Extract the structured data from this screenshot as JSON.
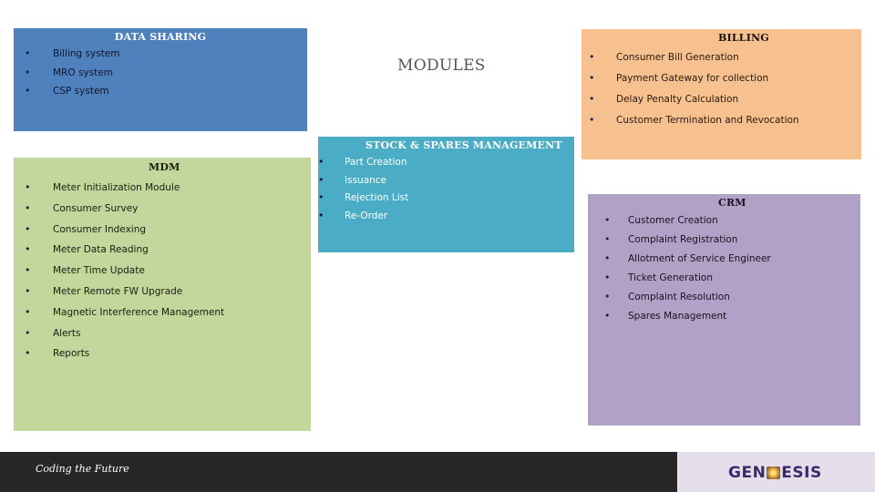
{
  "page": {
    "title": "MODULES"
  },
  "colors": {
    "data_sharing_bg": "#4f81bd",
    "billing_bg": "#f6c08f",
    "stock_bg": "#4bacc6",
    "mdm_bg": "#c3d69b",
    "crm_bg": "#b2a1c7",
    "footer_dark": "#262626",
    "footer_light": "#e5dfec",
    "logo_color": "#3b2a6b"
  },
  "modules": {
    "data_sharing": {
      "title": "DATA SHARING",
      "items": [
        "Billing system",
        "MRO system",
        "CSP system"
      ]
    },
    "billing": {
      "title": "BILLING",
      "items": [
        "Consumer Bill Generation",
        "Payment Gateway for collection",
        "Delay Penalty Calculation",
        "Customer Termination and Revocation"
      ]
    },
    "stock": {
      "title": "STOCK & SPARES MANAGEMENT",
      "items": [
        "Part Creation",
        "Issuance",
        "Rejection List",
        "Re-Order"
      ]
    },
    "mdm": {
      "title": "MDM",
      "items": [
        "Meter Initialization Module",
        "Consumer Survey",
        "Consumer Indexing",
        "Meter Data Reading",
        "Meter Time Update",
        "Meter Remote FW Upgrade",
        "Magnetic Interference Management",
        "Alerts",
        "Reports"
      ]
    },
    "crm": {
      "title": "CRM",
      "items": [
        "Customer Creation",
        "Complaint Registration",
        "Allotment of Service Engineer",
        "Ticket Generation",
        "Complaint Resolution",
        "Spares Management"
      ]
    }
  },
  "footer": {
    "tagline": "Coding the Future",
    "logo_left": "GEN",
    "logo_right": "ESIS",
    "logo_icon": "genesis-logo-mark"
  },
  "bullet_glyph": "•"
}
